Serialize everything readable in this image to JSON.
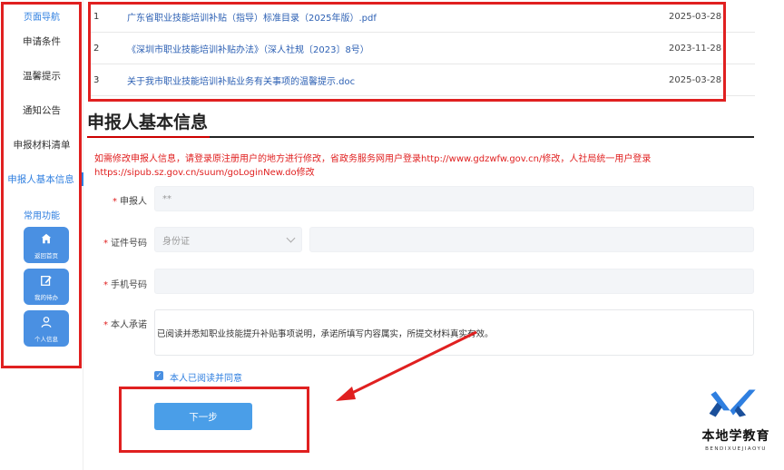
{
  "sidebar": {
    "nav_heading": "页面导航",
    "items": [
      {
        "label": "申请条件"
      },
      {
        "label": "温馨提示"
      },
      {
        "label": "通知公告"
      },
      {
        "label": "申报材料清单"
      },
      {
        "label": "申报人基本信息"
      }
    ],
    "func_heading": "常用功能",
    "buttons": [
      {
        "label": "返回首页",
        "icon": "home-icon"
      },
      {
        "label": "我的待办",
        "icon": "edit-icon"
      },
      {
        "label": "个人信息",
        "icon": "user-icon"
      }
    ]
  },
  "files": [
    {
      "index": "1",
      "name": "广东省职业技能培训补贴（指导）标准目录（2025年版）.pdf",
      "date": "2025-03-28"
    },
    {
      "index": "2",
      "name": "《深圳市职业技能培训补贴办法》（深人社规〔2023〕8号）",
      "date": "2023-11-28"
    },
    {
      "index": "3",
      "name": "关于我市职业技能培训补贴业务有关事项的温馨提示.doc",
      "date": "2025-03-28"
    }
  ],
  "section": {
    "title": "申报人基本信息",
    "notice": "如需修改申报人信息，请登录原注册用户的地方进行修改，省政务服务网用户登录http://www.gdzwfw.gov.cn/修改，人社局统一用户登录https://sipub.sz.gov.cn/suum/goLoginNew.do修改"
  },
  "form": {
    "applicant_label": "申报人",
    "applicant_value": "**",
    "id_label": "证件号码",
    "id_type": "身份证",
    "phone_label": "手机号码",
    "pledge_label": "本人承诺",
    "pledge_text": "已阅读并悉知职业技能提升补贴事项说明，承诺所填写内容属实，所提交材料真实有效。",
    "agree_label": "本人已阅读并同意",
    "next_button": "下一步",
    "required_mark": "*"
  },
  "watermark": {
    "text": "本地学教育",
    "sub": "BENDIXUEJIAOYU"
  },
  "colors": {
    "accent": "#4a90e2",
    "link": "#2b5fb3",
    "alert": "#e02020",
    "highlight_box": "#e02020"
  }
}
